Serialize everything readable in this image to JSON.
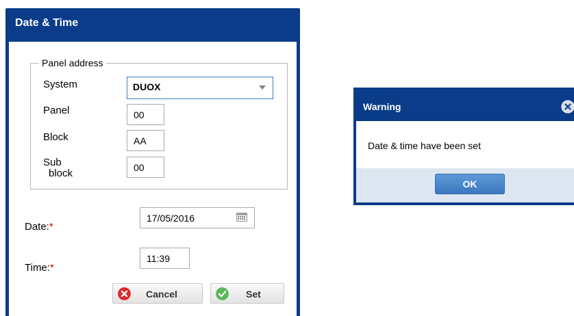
{
  "date_time_dialog": {
    "title": "Date & Time",
    "panel_address": {
      "legend": "Panel address",
      "system_label": "System",
      "system_value": "DUOX",
      "panel_label": "Panel",
      "panel_value": "00",
      "block_label": "Block",
      "block_value": "AA",
      "sub_label_line1": "Sub",
      "sub_label_line2": "block",
      "sub_value": "00"
    },
    "date_label": "Date:",
    "date_value": "17/05/2016",
    "time_label": "Time:",
    "time_value": "11:39",
    "required_marker": "*",
    "cancel_label": "Cancel",
    "set_label": "Set",
    "icons": {
      "cancel": "close-circle-icon",
      "set": "check-circle-icon",
      "date": "calendar-icon",
      "system": "chevron-down-icon"
    }
  },
  "warning_dialog": {
    "title": "Warning",
    "message": "Date & time have been set",
    "ok_label": "OK",
    "icons": {
      "close": "close-circle-icon"
    }
  },
  "colors": {
    "dialog_header": "#0a3c89",
    "required": "#cc0000",
    "cancel_icon": "#e0262a",
    "set_icon": "#5cb85c",
    "ok_button": "#3a78bf",
    "warning_footer": "#dde7f2"
  }
}
